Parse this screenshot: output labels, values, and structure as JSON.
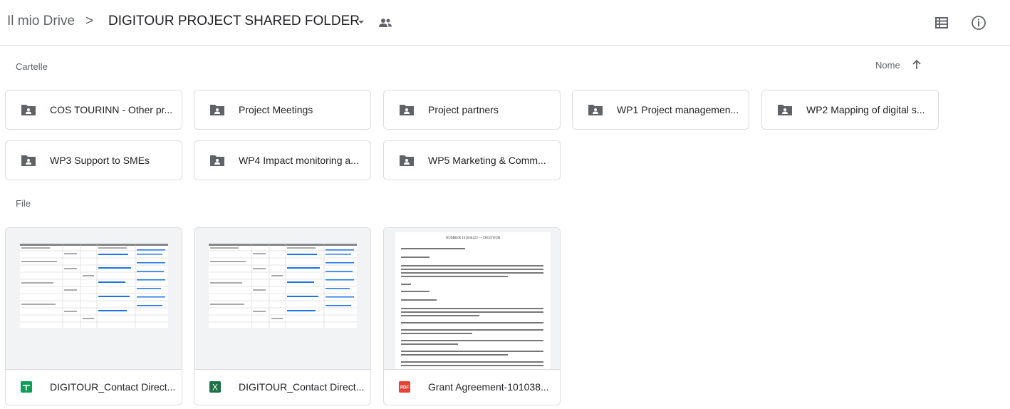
{
  "header": {
    "root": "Il mio Drive",
    "separator": ">",
    "current": "DIGITOUR PROJECT SHARED FOLDER",
    "icons": [
      "caret-down-icon",
      "shared-folder-icon",
      "list-view-icon",
      "info-icon"
    ]
  },
  "folders_section": {
    "label": "Cartelle",
    "sort_label": "Nome",
    "sort_direction": "ascending"
  },
  "folders": [
    {
      "name": "COS TOURINN - Other pr..."
    },
    {
      "name": "Project Meetings"
    },
    {
      "name": "Project partners"
    },
    {
      "name": "WP1 Project managemen..."
    },
    {
      "name": "WP2 Mapping of digital s..."
    },
    {
      "name": "WP3 Support to SMEs"
    },
    {
      "name": "WP4 Impact monitoring a..."
    },
    {
      "name": "WP5 Marketing & Comm..."
    }
  ],
  "files_section": {
    "label": "File"
  },
  "files": [
    {
      "name": "DIGITOUR_Contact Direct...",
      "type": "sheets",
      "type_icon": "google-sheets-icon",
      "color": "#0f9d58"
    },
    {
      "name": "DIGITOUR_Contact Direct...",
      "type": "excel",
      "type_icon": "excel-icon",
      "type_glyph": "X",
      "color": "#1e7145"
    },
    {
      "name": "Grant Agreement-101038...",
      "type": "pdf",
      "type_icon": "pdf-icon",
      "type_glyph": "PDF",
      "color": "#ea4335",
      "preview_title": "NUMBER 101038123 — DIGITOUR"
    }
  ],
  "colors": {
    "icon_gray": "#5f6368",
    "text": "#202124",
    "border": "#dadce0",
    "link_blue": "#1a73e8"
  }
}
